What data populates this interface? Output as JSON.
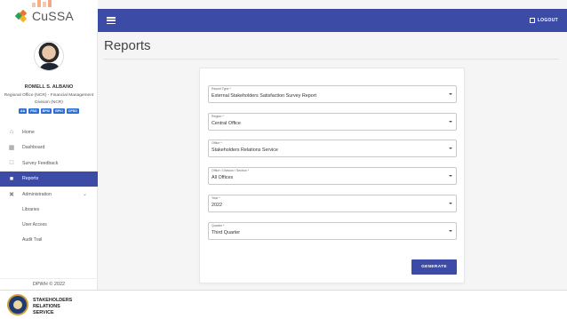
{
  "app": {
    "name": "CuSSA"
  },
  "topbar": {
    "logout_label": "LOGOUT"
  },
  "profile": {
    "name": "ROMELL S. ALBANO",
    "office_line1": "Regional Office (NCR) - Financial Management",
    "office_line2": "Division (NCR)",
    "roles": [
      "AA",
      "FSO",
      "BPKI",
      "BPKI",
      "CPSO"
    ]
  },
  "nav": {
    "items": [
      {
        "label": "Home",
        "icon": "home-icon"
      },
      {
        "label": "Dashboard",
        "icon": "dashboard-icon"
      },
      {
        "label": "Survey Feedback",
        "icon": "feedback-icon"
      },
      {
        "label": "Reports",
        "icon": "report-icon"
      },
      {
        "label": "Administration",
        "icon": "tools-icon"
      }
    ],
    "sub_items": [
      "Libraries",
      "User Access",
      "Audit Trail"
    ]
  },
  "footer": {
    "copyright": "DPWH © 2022"
  },
  "brand_bottom": {
    "line1": "STAKEHOLDERS",
    "line2": "RELATIONS",
    "line3": "SERVICE"
  },
  "page": {
    "title": "Reports"
  },
  "form": {
    "fields": [
      {
        "label": "Report Type *",
        "value": "External Stakeholders Satisfaction Survey Report"
      },
      {
        "label": "Region *",
        "value": "Central Office"
      },
      {
        "label": "Office *",
        "value": "Stakeholders Relations Service"
      },
      {
        "label": "Office / Division / Section *",
        "value": "All Offices"
      },
      {
        "label": "Year *",
        "value": "2022"
      },
      {
        "label": "Quarter *",
        "value": "Third Quarter"
      }
    ],
    "generate_label": "GENERATE"
  },
  "colors": {
    "primary": "#3c4ba6",
    "badge": "#2f6fcf"
  }
}
